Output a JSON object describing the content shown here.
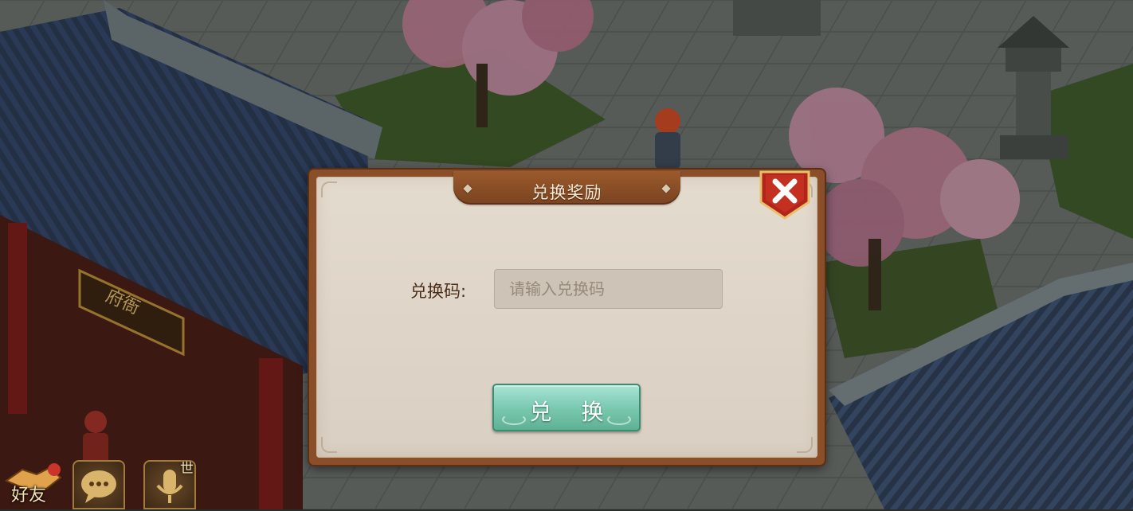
{
  "dialog": {
    "title": "兑换奖励",
    "code_label": "兑换码:",
    "code_input": {
      "value": "",
      "placeholder": "请输入兑换码"
    },
    "redeem_label": "兑 换",
    "close_icon": "close-x-icon"
  },
  "hud": {
    "friends_label": "好友",
    "world_tag": "世",
    "icons": [
      "handshake-icon",
      "chat-bubble-icon",
      "microphone-icon"
    ]
  },
  "scene": {
    "signboard_text": "府衙"
  },
  "colors": {
    "frame": "#8a4f28",
    "parchment": "#e4dbcf",
    "button_green": "#77c7ad",
    "close_red": "#b3241c"
  }
}
